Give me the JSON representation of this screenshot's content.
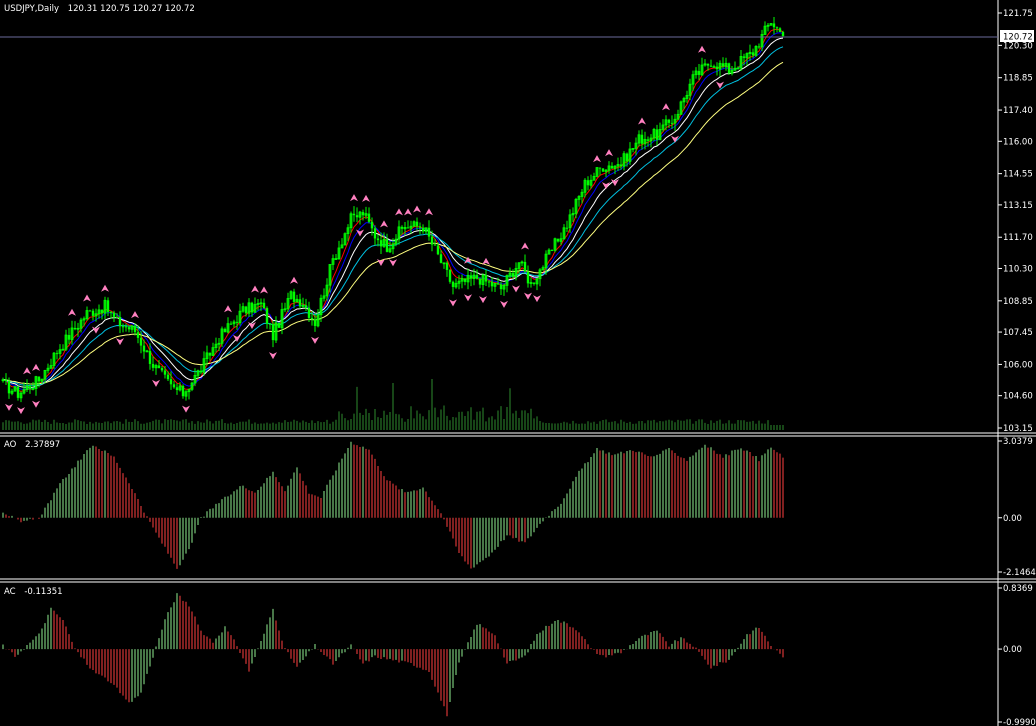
{
  "main": {
    "symbol": "USDJPY,Daily",
    "ohlc": "120.31 120.75 120.27 120.72",
    "price_ticks": [
      "121.75",
      "120.30",
      "118.85",
      "117.40",
      "116.00",
      "114.55",
      "113.15",
      "111.70",
      "110.30",
      "108.85",
      "107.45",
      "106.00",
      "104.60",
      "103.15"
    ],
    "current_price": "120.72"
  },
  "ao": {
    "label": "AO",
    "value": "2.37897",
    "ticks": [
      "3.0379",
      "0.00",
      "-2.1464"
    ]
  },
  "ac": {
    "label": "AC",
    "value": "-0.11351",
    "ticks": [
      "0.8369",
      "0.00",
      "-0.9990"
    ]
  },
  "colors": {
    "background": "#000000",
    "candle": "#00ff00",
    "fractal": "#ff80c0",
    "ma_fast": "#ff0000",
    "ma_mid": "#0000ff",
    "ma_white": "#ffffff",
    "ma_cyan": "#00c0e0",
    "ma_slow": "#ffff80",
    "bar_up": "#90ee90",
    "bar_down": "#ff4040",
    "volume": "#2e8b2e",
    "grid_line": "#6a6a9a"
  },
  "chart_data": [
    {
      "type": "candlestick",
      "title": "USDJPY,Daily",
      "ylim": [
        103.15,
        121.75
      ],
      "last_price": 120.72,
      "x_unit": "bar index (daily bars, left to right)",
      "close_anchor_points": [
        [
          0,
          105.1
        ],
        [
          5,
          104.7
        ],
        [
          12,
          105.3
        ],
        [
          18,
          106.6
        ],
        [
          28,
          108.3
        ],
        [
          34,
          108.6
        ],
        [
          38,
          107.9
        ],
        [
          44,
          107.5
        ],
        [
          50,
          106.0
        ],
        [
          56,
          105.0
        ],
        [
          60,
          104.7
        ],
        [
          66,
          105.8
        ],
        [
          72,
          107.2
        ],
        [
          80,
          108.4
        ],
        [
          86,
          108.7
        ],
        [
          90,
          107.3
        ],
        [
          96,
          109.1
        ],
        [
          100,
          108.8
        ],
        [
          104,
          107.9
        ],
        [
          110,
          110.7
        ],
        [
          116,
          112.5
        ],
        [
          120,
          112.8
        ],
        [
          124,
          111.8
        ],
        [
          128,
          111.3
        ],
        [
          134,
          112.2
        ],
        [
          140,
          112.2
        ],
        [
          146,
          110.6
        ],
        [
          150,
          109.5
        ],
        [
          158,
          109.9
        ],
        [
          166,
          109.4
        ],
        [
          172,
          110.6
        ],
        [
          176,
          109.6
        ],
        [
          182,
          110.9
        ],
        [
          188,
          112.3
        ],
        [
          194,
          114.1
        ],
        [
          200,
          114.9
        ],
        [
          206,
          115.0
        ],
        [
          212,
          116.1
        ],
        [
          218,
          116.3
        ],
        [
          224,
          117.1
        ],
        [
          230,
          118.8
        ],
        [
          236,
          119.6
        ],
        [
          242,
          119.2
        ],
        [
          250,
          120.0
        ],
        [
          256,
          121.4
        ],
        [
          260,
          120.72
        ]
      ],
      "fractals_up_count": 25,
      "fractals_down_count": 25,
      "moving_averages": [
        "red",
        "blue",
        "white",
        "cyan",
        "yellow"
      ]
    },
    {
      "type": "bar",
      "title": "AO",
      "value": 2.37897,
      "ylim": [
        -2.1464,
        3.0379
      ],
      "x_unit": "bar index",
      "anchor_points": [
        [
          0,
          0.25
        ],
        [
          6,
          -0.2
        ],
        [
          12,
          0.0
        ],
        [
          20,
          1.5
        ],
        [
          30,
          2.9
        ],
        [
          37,
          2.4
        ],
        [
          43,
          1.2
        ],
        [
          48,
          0.0
        ],
        [
          54,
          -1.2
        ],
        [
          58,
          -2.0
        ],
        [
          62,
          -1.3
        ],
        [
          66,
          0.0
        ],
        [
          72,
          0.6
        ],
        [
          80,
          1.3
        ],
        [
          84,
          1.0
        ],
        [
          90,
          1.8
        ],
        [
          94,
          1.1
        ],
        [
          98,
          2.0
        ],
        [
          102,
          1.0
        ],
        [
          106,
          0.8
        ],
        [
          110,
          1.7
        ],
        [
          116,
          3.0
        ],
        [
          122,
          2.7
        ],
        [
          128,
          1.5
        ],
        [
          134,
          1.0
        ],
        [
          140,
          1.2
        ],
        [
          146,
          0.2
        ],
        [
          152,
          -1.4
        ],
        [
          156,
          -2.0
        ],
        [
          162,
          -1.5
        ],
        [
          168,
          -0.7
        ],
        [
          174,
          -1.0
        ],
        [
          180,
          -0.1
        ],
        [
          186,
          0.6
        ],
        [
          192,
          1.8
        ],
        [
          198,
          2.7
        ],
        [
          204,
          2.5
        ],
        [
          210,
          2.7
        ],
        [
          216,
          2.4
        ],
        [
          222,
          2.7
        ],
        [
          228,
          2.3
        ],
        [
          234,
          2.9
        ],
        [
          240,
          2.4
        ],
        [
          246,
          2.8
        ],
        [
          252,
          2.3
        ],
        [
          256,
          2.8
        ],
        [
          260,
          2.38
        ]
      ]
    },
    {
      "type": "bar",
      "title": "AC",
      "value": -0.11351,
      "ylim": [
        -0.999,
        0.8369
      ],
      "x_unit": "bar index",
      "anchor_points": [
        [
          0,
          0.05
        ],
        [
          4,
          -0.1
        ],
        [
          8,
          0.05
        ],
        [
          12,
          0.2
        ],
        [
          16,
          0.55
        ],
        [
          20,
          0.4
        ],
        [
          24,
          0.0
        ],
        [
          30,
          -0.3
        ],
        [
          36,
          -0.45
        ],
        [
          42,
          -0.75
        ],
        [
          46,
          -0.6
        ],
        [
          50,
          -0.1
        ],
        [
          54,
          0.4
        ],
        [
          58,
          0.75
        ],
        [
          62,
          0.6
        ],
        [
          66,
          0.25
        ],
        [
          70,
          0.1
        ],
        [
          74,
          0.3
        ],
        [
          78,
          0.05
        ],
        [
          82,
          -0.3
        ],
        [
          86,
          0.1
        ],
        [
          90,
          0.55
        ],
        [
          94,
          0.0
        ],
        [
          98,
          -0.25
        ],
        [
          104,
          0.05
        ],
        [
          110,
          -0.2
        ],
        [
          116,
          0.05
        ],
        [
          120,
          -0.2
        ],
        [
          124,
          -0.1
        ],
        [
          130,
          -0.15
        ],
        [
          136,
          -0.2
        ],
        [
          142,
          -0.3
        ],
        [
          148,
          -0.9
        ],
        [
          152,
          -0.2
        ],
        [
          158,
          0.35
        ],
        [
          164,
          0.2
        ],
        [
          168,
          -0.2
        ],
        [
          174,
          -0.1
        ],
        [
          178,
          0.2
        ],
        [
          184,
          0.4
        ],
        [
          188,
          0.35
        ],
        [
          192,
          0.25
        ],
        [
          196,
          0.0
        ],
        [
          200,
          -0.1
        ],
        [
          206,
          -0.05
        ],
        [
          212,
          0.15
        ],
        [
          218,
          0.25
        ],
        [
          222,
          0.05
        ],
        [
          226,
          0.15
        ],
        [
          230,
          0.05
        ],
        [
          236,
          -0.25
        ],
        [
          242,
          -0.15
        ],
        [
          248,
          0.2
        ],
        [
          252,
          0.3
        ],
        [
          256,
          0.05
        ],
        [
          260,
          -0.11
        ]
      ]
    }
  ]
}
